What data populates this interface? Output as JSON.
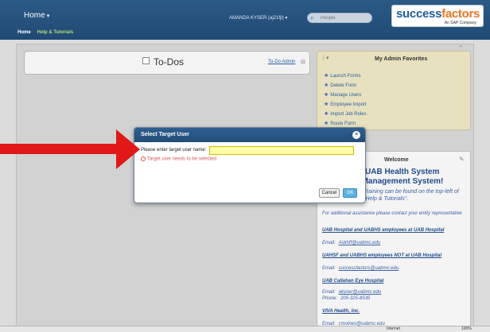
{
  "header": {
    "home_menu": "Home",
    "user_menu": "AMANDA KYSER (aj21fjl) ▾",
    "search_placeholder": "People",
    "logo_main": "success",
    "logo_accent": "factors",
    "logo_sub": "An SAP Company",
    "nav": {
      "home": "Home",
      "help": "Help & Tutorials"
    }
  },
  "todos": {
    "title": "To-Dos",
    "admin_link": "To-Do Admin"
  },
  "favorites": {
    "title": "My Admin Favorites",
    "items": [
      "Launch Forms",
      "Delete Form",
      "Manage Users",
      "Employee Import",
      "Import Job Roles",
      "Route Form"
    ]
  },
  "welcome": {
    "title": "Welcome",
    "heading": "to the UAB Health System\nance Management System!",
    "training": "Training can be found on the top-left of \"Help & Tutorials\".",
    "assistance": "For additional assistance please contact your entity representative",
    "entries": [
      {
        "heading": "UAB Hospital and UABHS employees at UAB Hospital",
        "email_label": "Email:",
        "email": "Askhff@uabmc.edu"
      },
      {
        "heading": "UAHSF and UABHS employees NOT at UAB Hospital",
        "email_label": "Email:",
        "email": "successfactors@uabmc.edu"
      },
      {
        "heading": "UAB Callahan Eye Hospital",
        "email_label": "Email:",
        "email": "akyser@uabmc.edu",
        "phone_label": "Phone:",
        "phone": "205-325-8535"
      },
      {
        "heading": "VIVA Health, Inc.",
        "email_label": "Email:",
        "email": "cmolnes@uabmc.edu"
      }
    ]
  },
  "dialog": {
    "title": "Select Target User",
    "close": "×",
    "label": "Please enter target user name:",
    "input_value": "",
    "error": "Target user needs to be selected",
    "cancel": "Cancel",
    "ok": "OK"
  },
  "statusbar": {
    "internet": "Internet",
    "zoom": "100%"
  },
  "colors": {
    "header_bg": "#2c5a86",
    "accent_orange": "#e87722",
    "arrow_red": "#e11818",
    "input_highlight": "#fdfca8"
  }
}
